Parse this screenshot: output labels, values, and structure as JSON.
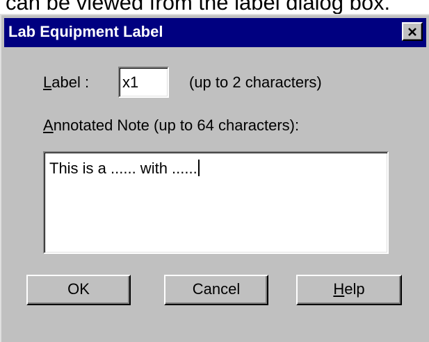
{
  "caption": "can be viewed from the label dialog box.",
  "dialog": {
    "title": "Lab Equipment Label",
    "label_prefix": "L",
    "label_rest": "abel :",
    "label_value": "x1",
    "label_hint": "(up to 2 characters)",
    "note_prefix": "A",
    "note_rest": "nnotated Note (up to 64 characters):",
    "note_value": "This is a ...... with ......",
    "buttons": {
      "ok": "OK",
      "cancel": "Cancel",
      "help_prefix": "H",
      "help_rest": "elp"
    }
  },
  "colors": {
    "titlebar": "#000080",
    "face": "#c0c0c0"
  },
  "icons": {
    "close": "close-icon"
  }
}
